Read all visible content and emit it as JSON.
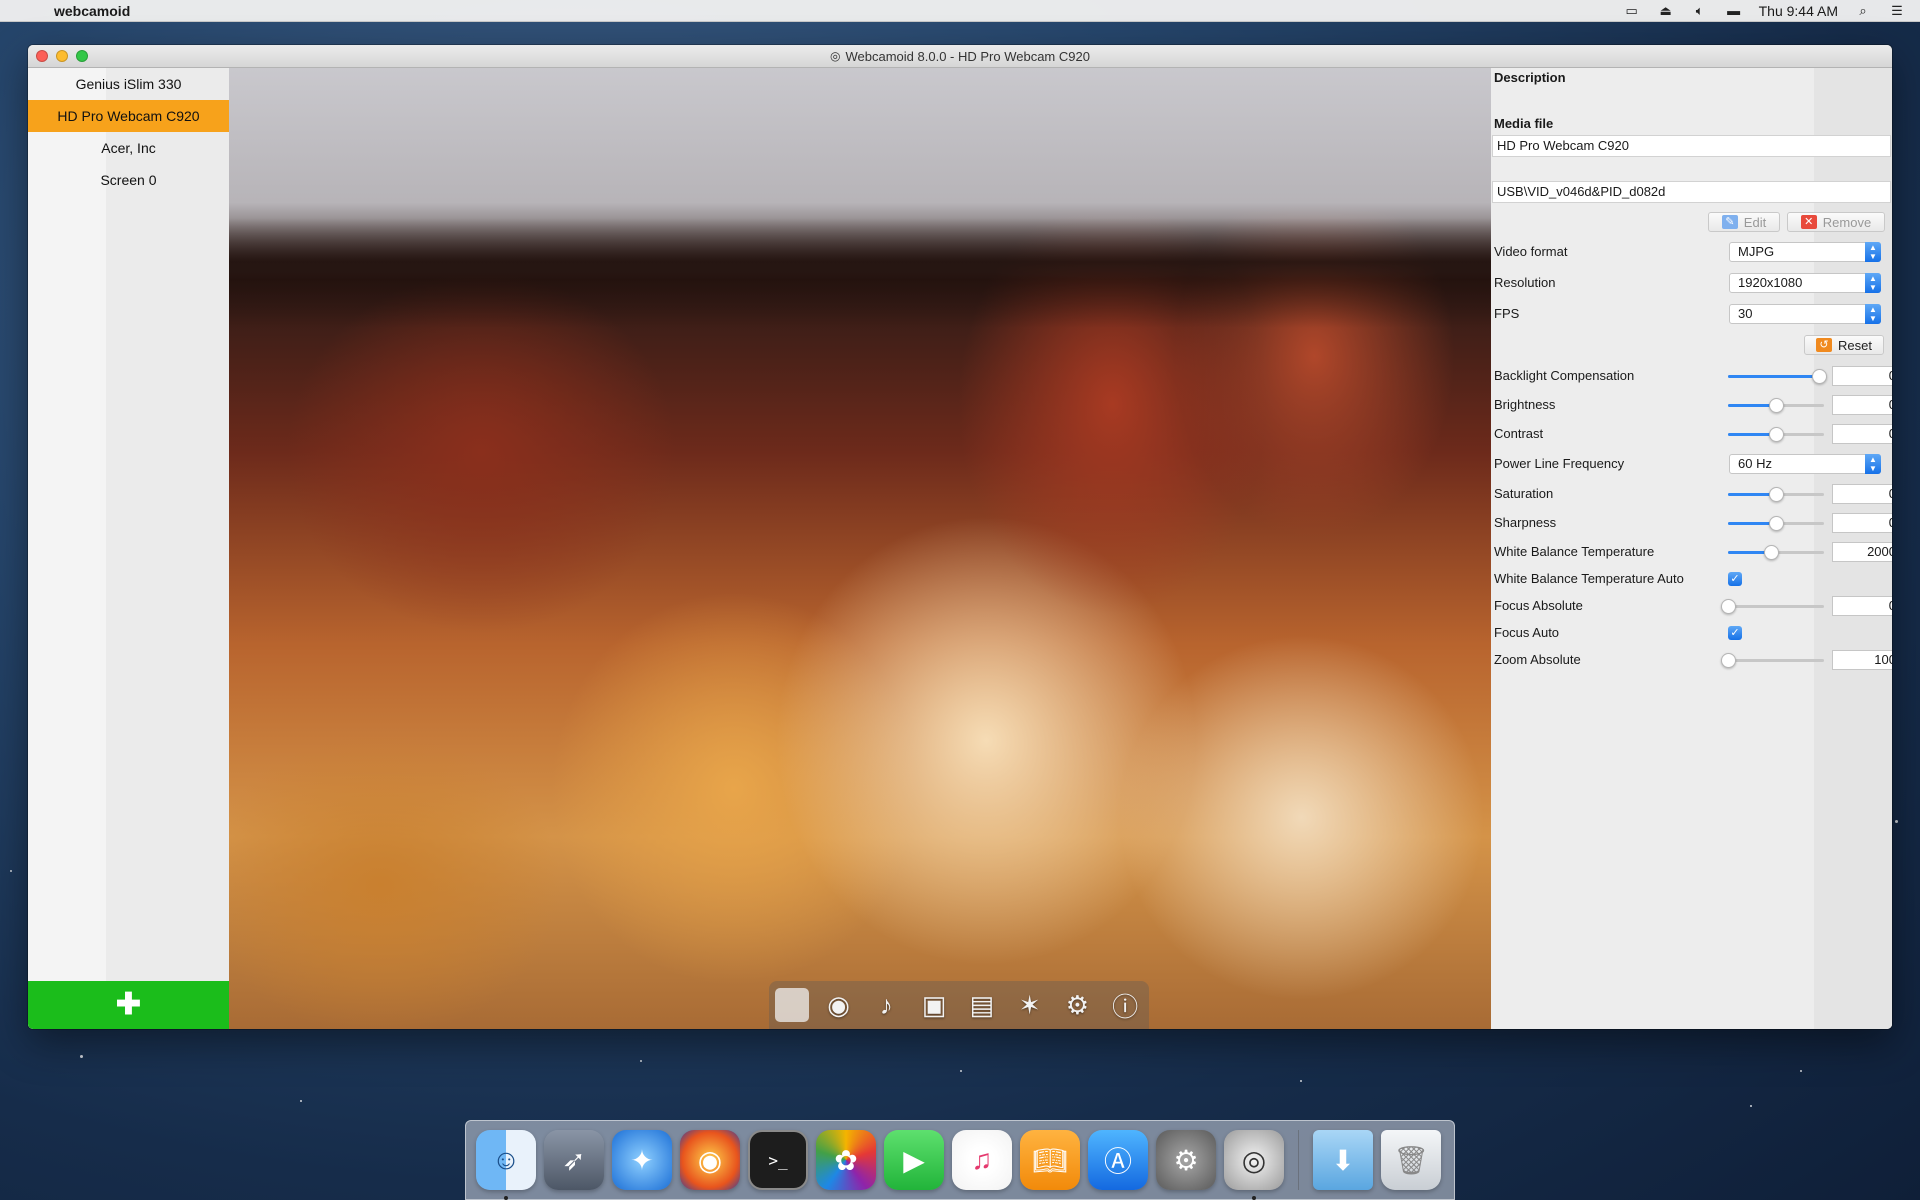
{
  "menubar": {
    "app_name": "webcamoid",
    "clock": "Thu 9:44 AM"
  },
  "window": {
    "title": "Webcamoid 8.0.0 - HD Pro Webcam C920"
  },
  "sources": [
    {
      "label": "Genius iSlim 330",
      "active": false
    },
    {
      "label": "HD Pro Webcam C920",
      "active": true
    },
    {
      "label": "Acer, Inc",
      "active": false
    },
    {
      "label": "Screen 0",
      "active": false
    }
  ],
  "add_button": {
    "label": "✚"
  },
  "panel": {
    "description_label": "Description",
    "description_value": "HD Pro Webcam C920",
    "media_file_label": "Media file",
    "media_file_value": "USB\\VID_v046d&PID_d082d",
    "edit_label": "Edit",
    "remove_label": "Remove",
    "video_format": {
      "label": "Video format",
      "value": "MJPG"
    },
    "resolution": {
      "label": "Resolution",
      "value": "1920x1080"
    },
    "fps": {
      "label": "FPS",
      "value": "30"
    },
    "reset_label": "Reset",
    "controls": {
      "backlight": {
        "label": "Backlight Compensation",
        "value": "0",
        "level": 0.95
      },
      "brightness": {
        "label": "Brightness",
        "value": "0",
        "level": 0.5
      },
      "contrast": {
        "label": "Contrast",
        "value": "0",
        "level": 0.5
      },
      "power_line": {
        "label": "Power Line Frequency",
        "value": "60 Hz"
      },
      "saturation": {
        "label": "Saturation",
        "value": "0",
        "level": 0.5
      },
      "sharpness": {
        "label": "Sharpness",
        "value": "0",
        "level": 0.5
      },
      "wb_temp": {
        "label": "White Balance Temperature",
        "value": "2000",
        "level": 0.45
      },
      "wb_auto": {
        "label": "White Balance Temperature Auto",
        "checked": true
      },
      "focus_abs": {
        "label": "Focus Absolute",
        "value": "0",
        "level": 0.0
      },
      "focus_auto": {
        "label": "Focus Auto",
        "checked": true
      },
      "zoom_abs": {
        "label": "Zoom Absolute",
        "value": "100",
        "level": 0.0
      }
    }
  },
  "toolbar_icons": [
    "record-icon",
    "webcam-icon",
    "music-note-icon",
    "camera-icon",
    "film-icon",
    "effects-wand-icon",
    "gear-icon",
    "info-icon"
  ],
  "dock_apps": [
    "Finder",
    "Launchpad",
    "Safari",
    "Firefox",
    "Terminal",
    "Photos",
    "FaceTime",
    "iTunes",
    "iBooks",
    "App Store",
    "System Preferences",
    "Webcamoid",
    "Downloads",
    "Trash"
  ],
  "colors": {
    "accent_orange": "#f7a21b",
    "add_green": "#1bbd1b",
    "macos_blue": "#2f86f3"
  }
}
